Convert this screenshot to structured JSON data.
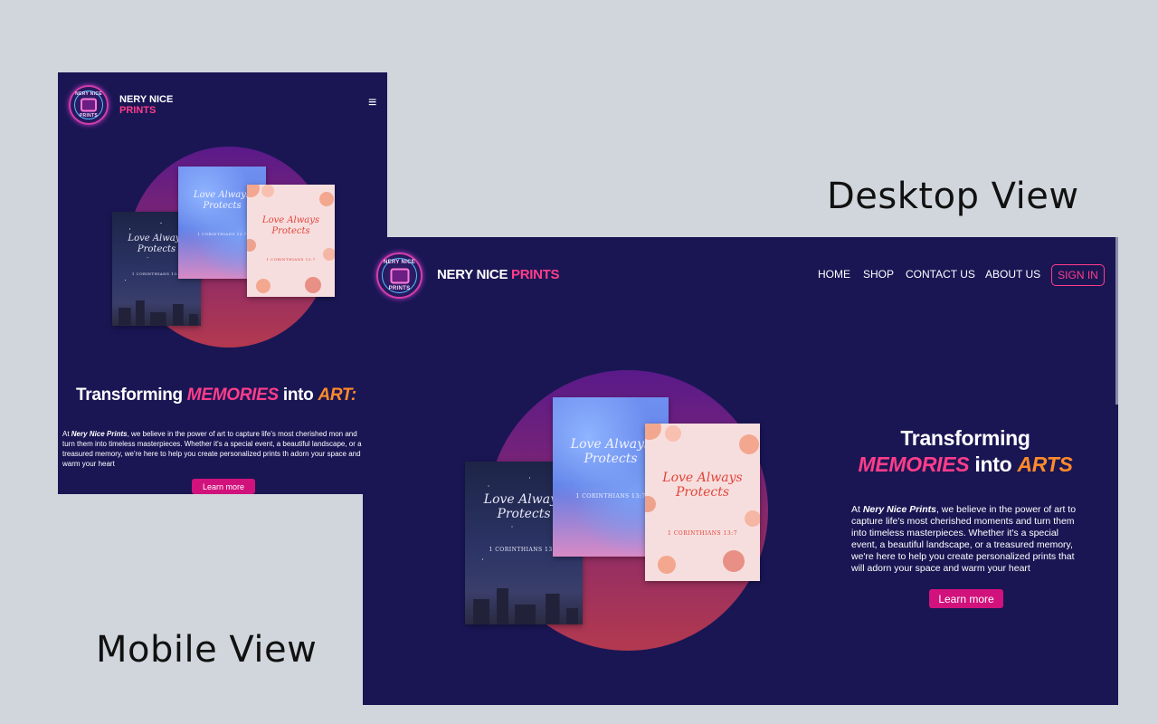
{
  "captions": {
    "desktop": "Desktop View",
    "mobile": "Mobile View"
  },
  "brand": {
    "line1": "NERY NICE",
    "line2": "PRINTS",
    "full_main": "NERY NICE ",
    "full_accent": "PRINTS",
    "badge_top": "NERY NICE",
    "badge_bottom": "PRINTS"
  },
  "nav": {
    "items": [
      "HOME",
      "SHOP",
      "CONTACT US",
      "ABOUT US"
    ],
    "sign_in": "SIGN IN",
    "menu_icon": "≡"
  },
  "cards": {
    "quote": "Love Always Protects",
    "reference": "1 CORINTHIANS 13:7"
  },
  "hero": {
    "headline_start": "Transforming ",
    "headline_memories": "MEMORIES",
    "headline_into": " into ",
    "headline_arts": "ARTS",
    "para_prefix": "At ",
    "para_brand": "Nery Nice Prints",
    "para_rest": ", we believe in the power of art to capture life's most cherished moments and turn them into timeless masterpieces. Whether it's a special event, a beautiful landscape, or a treasured memory, we're here to help you create personalized prints that will adorn your space and warm your heart",
    "button": "Learn more"
  },
  "mobile_hero": {
    "para_rest": ", we believe in the power of art to capture life's most cherished mon and turn them into timeless masterpieces. Whether it's a special event, a beautiful landscape, or a treasured memory, we're here to help you create personalized prints th adorn your space and warm your heart",
    "headline_arts_visible": "ART:"
  },
  "colors": {
    "background": "#d0d6dc",
    "screen": "#1a1654",
    "accent_pink": "#ff3d8a",
    "accent_orange": "#ff8a2a",
    "button": "#d1127c"
  }
}
